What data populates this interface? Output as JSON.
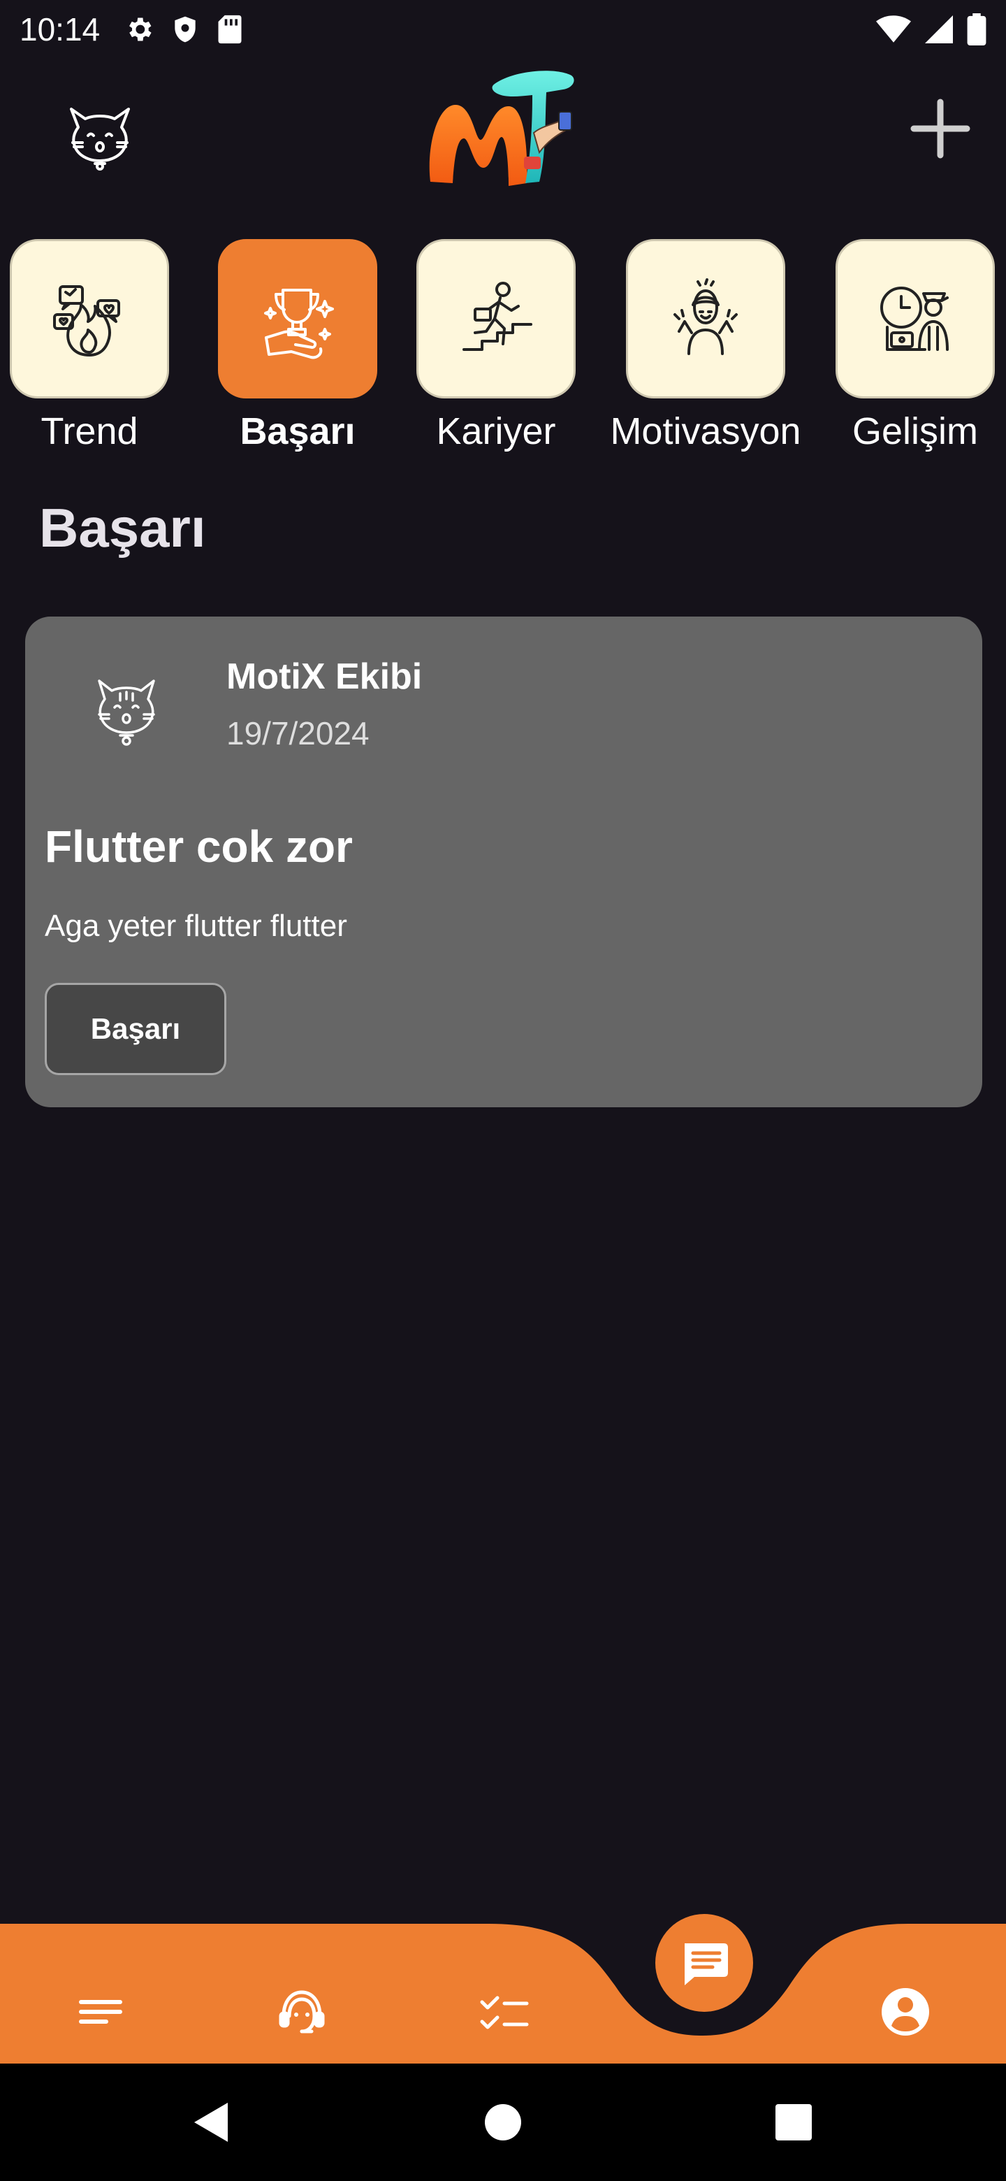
{
  "status_bar": {
    "time": "10:14",
    "left_icons": [
      "gear-icon",
      "shield-icon",
      "sd-card-icon"
    ],
    "right_icons": [
      "wifi-icon",
      "signal-icon",
      "battery-icon"
    ]
  },
  "app_bar": {
    "avatar_icon": "cat-face-icon",
    "logo_text": "MT",
    "add_icon": "plus-icon"
  },
  "categories": [
    {
      "label": "Trend",
      "icon": "trend-fire-icon",
      "active": false
    },
    {
      "label": "Başarı",
      "icon": "trophy-icon",
      "active": true
    },
    {
      "label": "Kariyer",
      "icon": "career-stairs-icon",
      "active": false
    },
    {
      "label": "Motivasyon",
      "icon": "motivation-person-icon",
      "active": false
    },
    {
      "label": "Gelişim",
      "icon": "development-clock-icon",
      "active": false
    }
  ],
  "section": {
    "title": "Başarı"
  },
  "post": {
    "author": "MotiX Ekibi",
    "date": "19/7/2024",
    "title": "Flutter cok zor",
    "body": "Aga yeter flutter flutter",
    "tag": "Başarı"
  },
  "bottom_nav": {
    "items": [
      "menu-icon",
      "support-agent-icon",
      "checklist-icon",
      "chat-icon",
      "profile-icon"
    ],
    "active": "chat-icon"
  },
  "colors": {
    "background": "#15121a",
    "accent": "#ee7e31",
    "tile": "#fef7dc",
    "card": "#666666"
  }
}
